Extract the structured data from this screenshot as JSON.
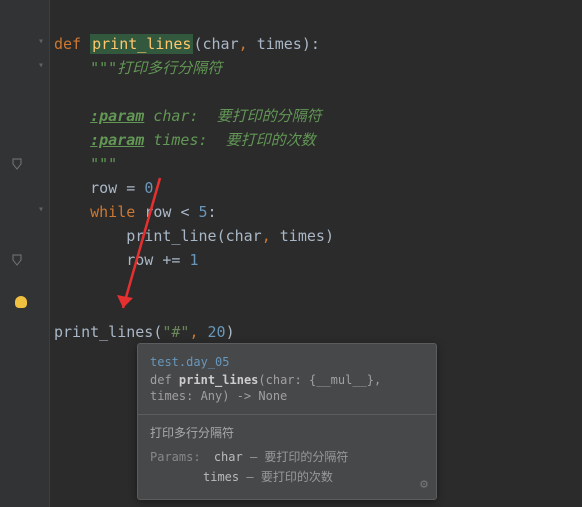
{
  "code": {
    "def": "def",
    "fn_name": "print_lines",
    "param1": "char",
    "param2": "times",
    "doc_open": "\"\"\"",
    "doc_summary": "打印多行分隔符",
    "param_tag": ":param",
    "doc_p1_name": "char:",
    "doc_p1_desc": "要打印的分隔符",
    "doc_p2_name": "times:",
    "doc_p2_desc": "要打印的次数",
    "doc_close": "\"\"\"",
    "row_var": "row",
    "eq": "=",
    "zero": "0",
    "while_kw": "while",
    "lt": "<",
    "five": "5",
    "inner_call": "print_line",
    "pluseq": "+=",
    "one": "1",
    "call_fn": "print_lines",
    "call_arg1": "\"#\"",
    "call_arg2": "20"
  },
  "tooltip": {
    "module": "test.day_05",
    "sig_def": "def",
    "sig_fn": "print_lines",
    "sig_line1": "(char: {__mul__},",
    "sig_line2_indent": "            ",
    "sig_line2": "times: Any) -> None",
    "desc": "打印多行分隔符",
    "params_label": "Params:",
    "p1_name": "char",
    "p1_sep": " – ",
    "p1_desc": "要打印的分隔符",
    "p2_name": "times",
    "p2_sep": " – ",
    "p2_desc": "要打印的次数"
  }
}
